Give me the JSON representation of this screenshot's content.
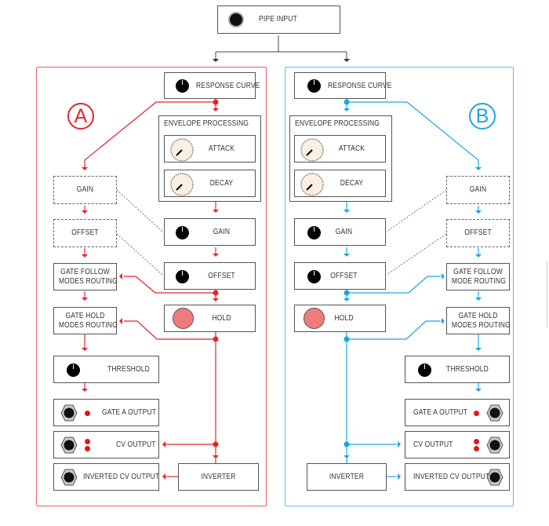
{
  "colors": {
    "channel_a": "#e8232b",
    "channel_b": "#19a7e0",
    "hold_button": "#f07b7b",
    "led": "#e0141c",
    "knob_cream": "#fbeee2"
  },
  "input": {
    "label": "PIPE INPUT",
    "icon": "jack-icon"
  },
  "channel_a": {
    "badge": "A",
    "response_curve": "RESPONSE CURVE",
    "envelope": {
      "title": "ENVELOPE PROCESSING",
      "attack": "ATTACK",
      "decay": "DECAY"
    },
    "gain": "GAIN",
    "offset": "OFFSET",
    "hold": "HOLD",
    "mod_gain": "GAIN",
    "mod_offset": "OFFSET",
    "gate_follow": [
      "GATE FOLLOW",
      "MODES ROUTING"
    ],
    "gate_hold": [
      "GATE HOLD",
      "MODES ROUTING"
    ],
    "threshold": "THRESHOLD",
    "gate_output": "GATE A OUTPUT",
    "cv_output": "CV OUTPUT",
    "inverted_cv_output": "INVERTED CV OUTPUT",
    "inverter": "INVERTER"
  },
  "channel_b": {
    "badge": "B",
    "response_curve": "RESPONSE CURVE",
    "envelope": {
      "title": "ENVELOPE PROCESSING",
      "attack": "ATTACK",
      "decay": "DECAY"
    },
    "gain": "GAIN",
    "offset": "OFFSET",
    "hold": "HOLD",
    "mod_gain": "GAIN",
    "mod_offset": "OFFSET",
    "gate_follow": [
      "GATE FOLLOW",
      "MODE ROUTING"
    ],
    "gate_hold": [
      "GATE HOLD",
      "MODES ROUTING"
    ],
    "threshold": "THRESHOLD",
    "gate_output": "GATE A OUTPUT",
    "cv_output": "CV OUTPUT",
    "inverted_cv_output": "INVERTED CV OUTPUT",
    "inverter": "INVERTER"
  }
}
